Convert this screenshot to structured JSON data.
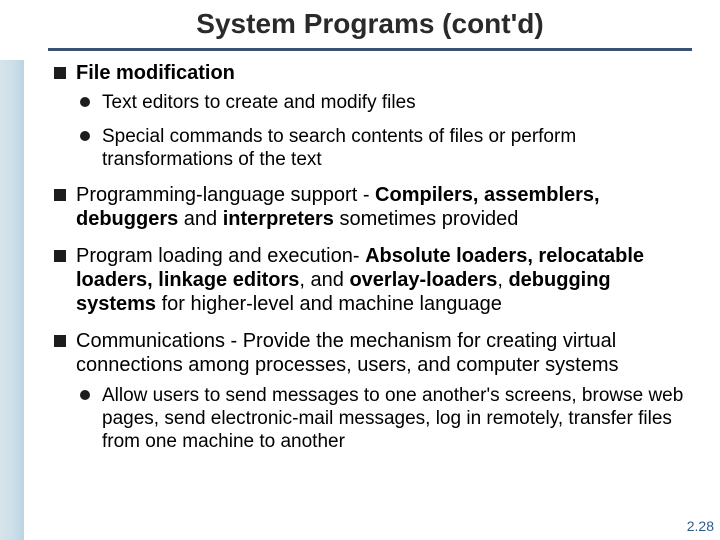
{
  "title": "System Programs (cont'd)",
  "b1": {
    "lead": "File modification",
    "sub1": "Text editors to create and modify files",
    "sub2": "Special commands to search contents of files or perform transformations of the text"
  },
  "b2": {
    "lead": "Programming-language support - ",
    "bold": "Compilers, assemblers, debuggers",
    "mid": " and ",
    "bold2": "interpreters",
    "rest": " sometimes provided"
  },
  "b3": {
    "lead": "Program loading and execution- ",
    "bold": "Absolute loaders, relocatable loaders, linkage editors",
    "mid": ", and ",
    "bold2": "overlay-loaders",
    "mid2": ", ",
    "bold3": "debugging systems",
    "rest": " for higher-level and machine language"
  },
  "b4": {
    "lead": "Communications - Provide the mechanism for creating virtual connections among processes, users, and computer systems",
    "sub1": "Allow users to send messages to one another's screens, browse web pages, send electronic-mail messages, log in remotely, transfer files from one machine to another"
  },
  "pagenum": "2.28"
}
